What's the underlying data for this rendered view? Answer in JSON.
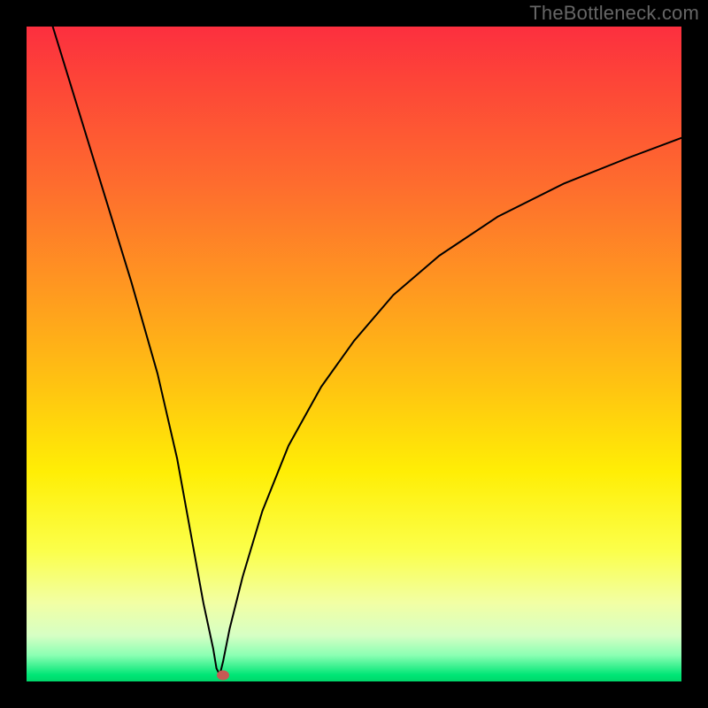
{
  "watermark": "TheBottleneck.com",
  "chart_data": {
    "type": "line",
    "title": "",
    "xlabel": "",
    "ylabel": "",
    "xlim": [
      0,
      100
    ],
    "ylim": [
      0,
      100
    ],
    "grid": false,
    "legend": false,
    "background_gradient": {
      "direction": "vertical",
      "stops": [
        {
          "pos": 0,
          "color": "#fc2f3f"
        },
        {
          "pos": 24,
          "color": "#fe6c2e"
        },
        {
          "pos": 55,
          "color": "#ffc411"
        },
        {
          "pos": 80,
          "color": "#fbff4a"
        },
        {
          "pos": 96,
          "color": "#8bffb3"
        },
        {
          "pos": 100,
          "color": "#00d66a"
        }
      ]
    },
    "series": [
      {
        "name": "bottleneck-curve",
        "x": [
          4,
          8,
          12,
          16,
          20,
          23,
          25,
          27,
          28.5,
          29,
          29.5,
          30,
          31,
          33,
          36,
          40,
          45,
          50,
          56,
          63,
          72,
          82,
          92,
          100
        ],
        "y": [
          100,
          87,
          74,
          61,
          47,
          34,
          23,
          12,
          5,
          2,
          1,
          3,
          8,
          16,
          26,
          36,
          45,
          52,
          59,
          65,
          71,
          76,
          80,
          83
        ]
      }
    ],
    "marker": {
      "x": 30,
      "y": 1,
      "color": "#c75a54"
    },
    "curve_color": "#000000",
    "curve_width": 2
  }
}
